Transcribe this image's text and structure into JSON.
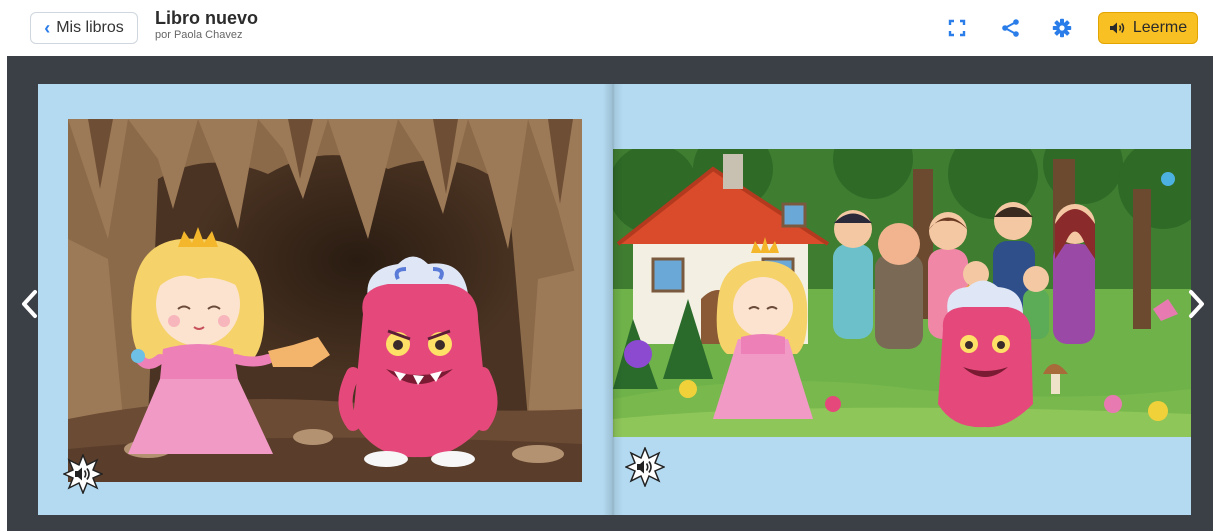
{
  "header": {
    "back_label": "Mis libros",
    "title": "Libro nuevo",
    "author": "por Paola Chavez",
    "read_label": "Leerme"
  },
  "icons": {
    "back": "chevron-left-icon",
    "fullscreen": "fullscreen-icon",
    "share": "share-icon",
    "settings": "gear-icon",
    "read": "speaker-icon",
    "prev": "chevron-left-icon",
    "next": "chevron-right-icon",
    "audio": "speaker-burst-icon"
  },
  "colors": {
    "accent": "#2b7de9",
    "read_button": "#f9c023",
    "stage": "#3b3f46",
    "page": "#b3daf1"
  }
}
